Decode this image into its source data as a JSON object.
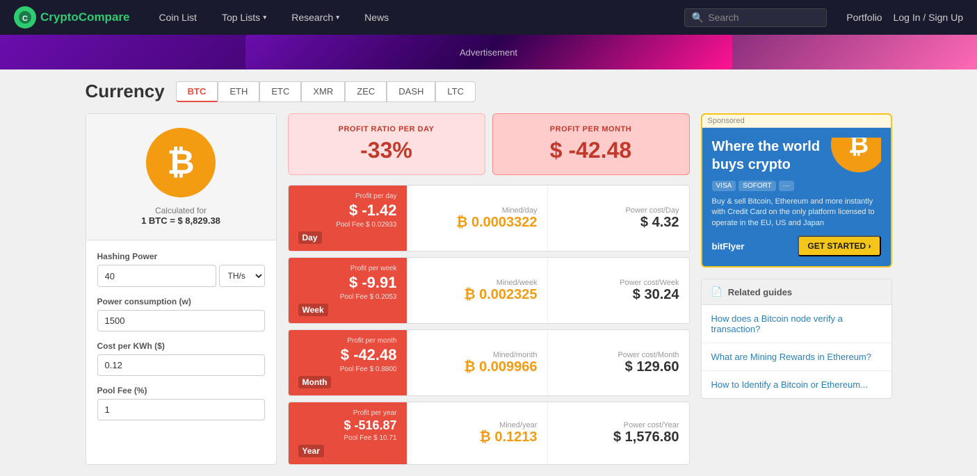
{
  "navbar": {
    "logo_text_1": "Crypto",
    "logo_text_2": "Compare",
    "nav_items": [
      {
        "label": "Coin List",
        "id": "coin-list"
      },
      {
        "label": "Top Lists",
        "id": "top-lists",
        "dropdown": true
      },
      {
        "label": "Research",
        "id": "research",
        "dropdown": true
      },
      {
        "label": "News",
        "id": "news"
      }
    ],
    "search_placeholder": "Search",
    "portfolio_label": "Portfolio",
    "login_label": "Log In / Sign Up"
  },
  "currency": {
    "title": "Currency",
    "tabs": [
      "BTC",
      "ETH",
      "ETC",
      "XMR",
      "ZEC",
      "DASH",
      "LTC"
    ],
    "active_tab": "BTC"
  },
  "coin_info": {
    "symbol": "₿",
    "calc_label": "Calculated for",
    "calc_value": "1 BTC = $ 8,829.38"
  },
  "form": {
    "hashing_power_label": "Hashing Power",
    "hashing_power_value": "40",
    "hashing_power_unit": "TH/s",
    "power_consumption_label": "Power consumption (w)",
    "power_consumption_value": "1500",
    "cost_per_kwh_label": "Cost per KWh ($)",
    "cost_per_kwh_value": "0.12",
    "pool_fee_label": "Pool Fee (%)",
    "pool_fee_value": "1"
  },
  "profit_summary": {
    "ratio_label": "PROFIT RATIO PER DAY",
    "ratio_value": "-33%",
    "month_label": "PROFIT PER MONTH",
    "month_value": "$ -42.48"
  },
  "profit_rows": [
    {
      "period": "Day",
      "profit_label": "Profit per day",
      "profit_value": "$ -1.42",
      "pool_fee": "Pool Fee $ 0.02933",
      "mined_label": "Mined/day",
      "mined_value": "₿ 0.0003322",
      "power_label": "Power cost/Day",
      "power_value": "$ 4.32"
    },
    {
      "period": "Week",
      "profit_label": "Profit per week",
      "profit_value": "$ -9.91",
      "pool_fee": "Pool Fee $ 0.2053",
      "mined_label": "Mined/week",
      "mined_value": "₿ 0.002325",
      "power_label": "Power cost/Week",
      "power_value": "$ 30.24"
    },
    {
      "period": "Month",
      "profit_label": "Profit per month",
      "profit_value": "$ -42.48",
      "pool_fee": "Pool Fee $ 0.8800",
      "mined_label": "Mined/month",
      "mined_value": "₿ 0.009966",
      "power_label": "Power cost/Month",
      "power_value": "$ 129.60"
    },
    {
      "period": "Year",
      "profit_label": "Profit per year",
      "profit_value": "$ -516.87",
      "pool_fee": "Pool Fee $ 10.71",
      "mined_label": "Mined/year",
      "mined_value": "₿ 0.1213",
      "power_label": "Power cost/Year",
      "power_value": "$ 1,576.80"
    }
  ],
  "ad": {
    "sponsored_label": "Sponsored",
    "title": "Where the world buys crypto",
    "description": "Buy & sell Bitcoin, Ethereum and more instantly with Credit Card on the only platform licensed to operate in the EU, US and Japan",
    "payment_icons": [
      "VISA",
      "SOFORT",
      "..."
    ],
    "logo": "bitFlyer",
    "cta": "GET STARTED ›"
  },
  "related_guides": {
    "header": "Related guides",
    "items": [
      "How does a Bitcoin node verify a transaction?",
      "What are Mining Rewards in Ethereum?",
      "How to Identify a Bitcoin or Ethereum..."
    ]
  }
}
